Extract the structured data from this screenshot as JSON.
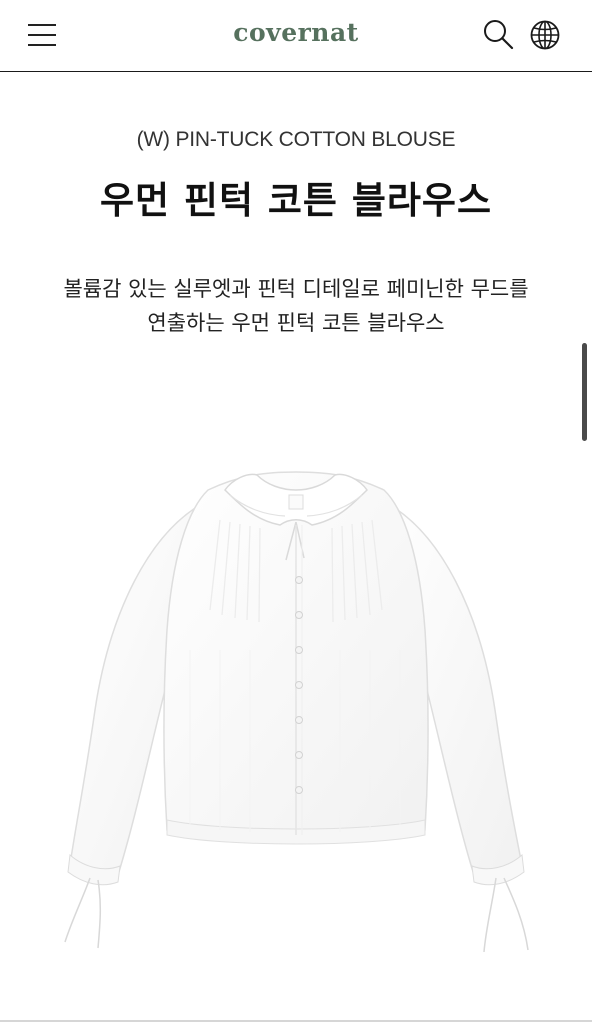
{
  "header": {
    "logo": "covernat",
    "menu_icon": "hamburger-menu-icon",
    "search_icon": "search-icon",
    "language_icon": "globe-icon",
    "logo_color": "#56715e"
  },
  "product": {
    "subtitle": "(W) PIN-TUCK COTTON BLOUSE",
    "title": "우먼 핀턱 코튼 블라우스",
    "description_line1": "볼륨감 있는 실루엣과 핀턱 디테일로 페미닌한 무드를",
    "description_line2": "연출하는 우먼 핀턱 코튼 블라우스",
    "image": "white-blouse-product-image"
  }
}
